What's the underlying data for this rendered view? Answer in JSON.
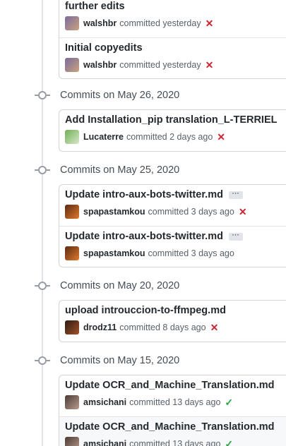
{
  "groups": [
    {
      "title": "",
      "commits": [
        {
          "title": "further edits",
          "author": "walshbr",
          "verb": "committed",
          "when": "yesterday",
          "status": "failure",
          "status_icon": "✕",
          "avatar_colors": [
            "#7b6a9d",
            "#c9a27e"
          ]
        },
        {
          "title": "Initial copyedits",
          "author": "walshbr",
          "verb": "committed",
          "when": "yesterday",
          "status": "failure",
          "status_icon": "✕",
          "avatar_colors": [
            "#7b6a9d",
            "#c9a27e"
          ]
        }
      ]
    },
    {
      "title": "Commits on May 26, 2020",
      "commits": [
        {
          "title": "Add Installation_pip translation_L-TERRIEL",
          "author": "Lucaterre",
          "verb": "committed",
          "when": "2 days ago",
          "status": "failure",
          "status_icon": "✕",
          "avatar_colors": [
            "#6fae57",
            "#d9e8c8"
          ]
        }
      ]
    },
    {
      "title": "Commits on May 25, 2020",
      "commits": [
        {
          "title": "Update intro-aux-bots-twitter.md",
          "author": "spapastamkou",
          "verb": "committed",
          "when": "3 days ago",
          "status": "failure",
          "status_icon": "✕",
          "ellipsis": "···",
          "avatar_colors": [
            "#5a2a12",
            "#e07a2c"
          ]
        },
        {
          "title": "Update intro-aux-bots-twitter.md",
          "author": "spapastamkou",
          "verb": "committed",
          "when": "3 days ago",
          "status": "none",
          "status_icon": "",
          "ellipsis": "···",
          "avatar_colors": [
            "#5a2a12",
            "#e07a2c"
          ]
        }
      ]
    },
    {
      "title": "Commits on May 20, 2020",
      "commits": [
        {
          "title": "upload introuccion-to-ffmpeg.md",
          "author": "drodz11",
          "verb": "committed",
          "when": "8 days ago",
          "status": "failure",
          "status_icon": "✕",
          "avatar_colors": [
            "#2b1a10",
            "#a3522a"
          ]
        }
      ]
    },
    {
      "title": "Commits on May 15, 2020",
      "commits": [
        {
          "title": "Update OCR_and_Machine_Translation.md",
          "author": "amsichani",
          "verb": "committed",
          "when": "13 days ago",
          "status": "success",
          "status_icon": "✓",
          "avatar_colors": [
            "#4a3a36",
            "#b99b8c"
          ]
        },
        {
          "title": "Update OCR_and_Machine_Translation.md",
          "author": "amsichani",
          "verb": "committed",
          "when": "13 days ago",
          "status": "success",
          "status_icon": "✓",
          "avatar_colors": [
            "#4a3a36",
            "#b99b8c"
          ],
          "shaded": true
        }
      ]
    }
  ]
}
